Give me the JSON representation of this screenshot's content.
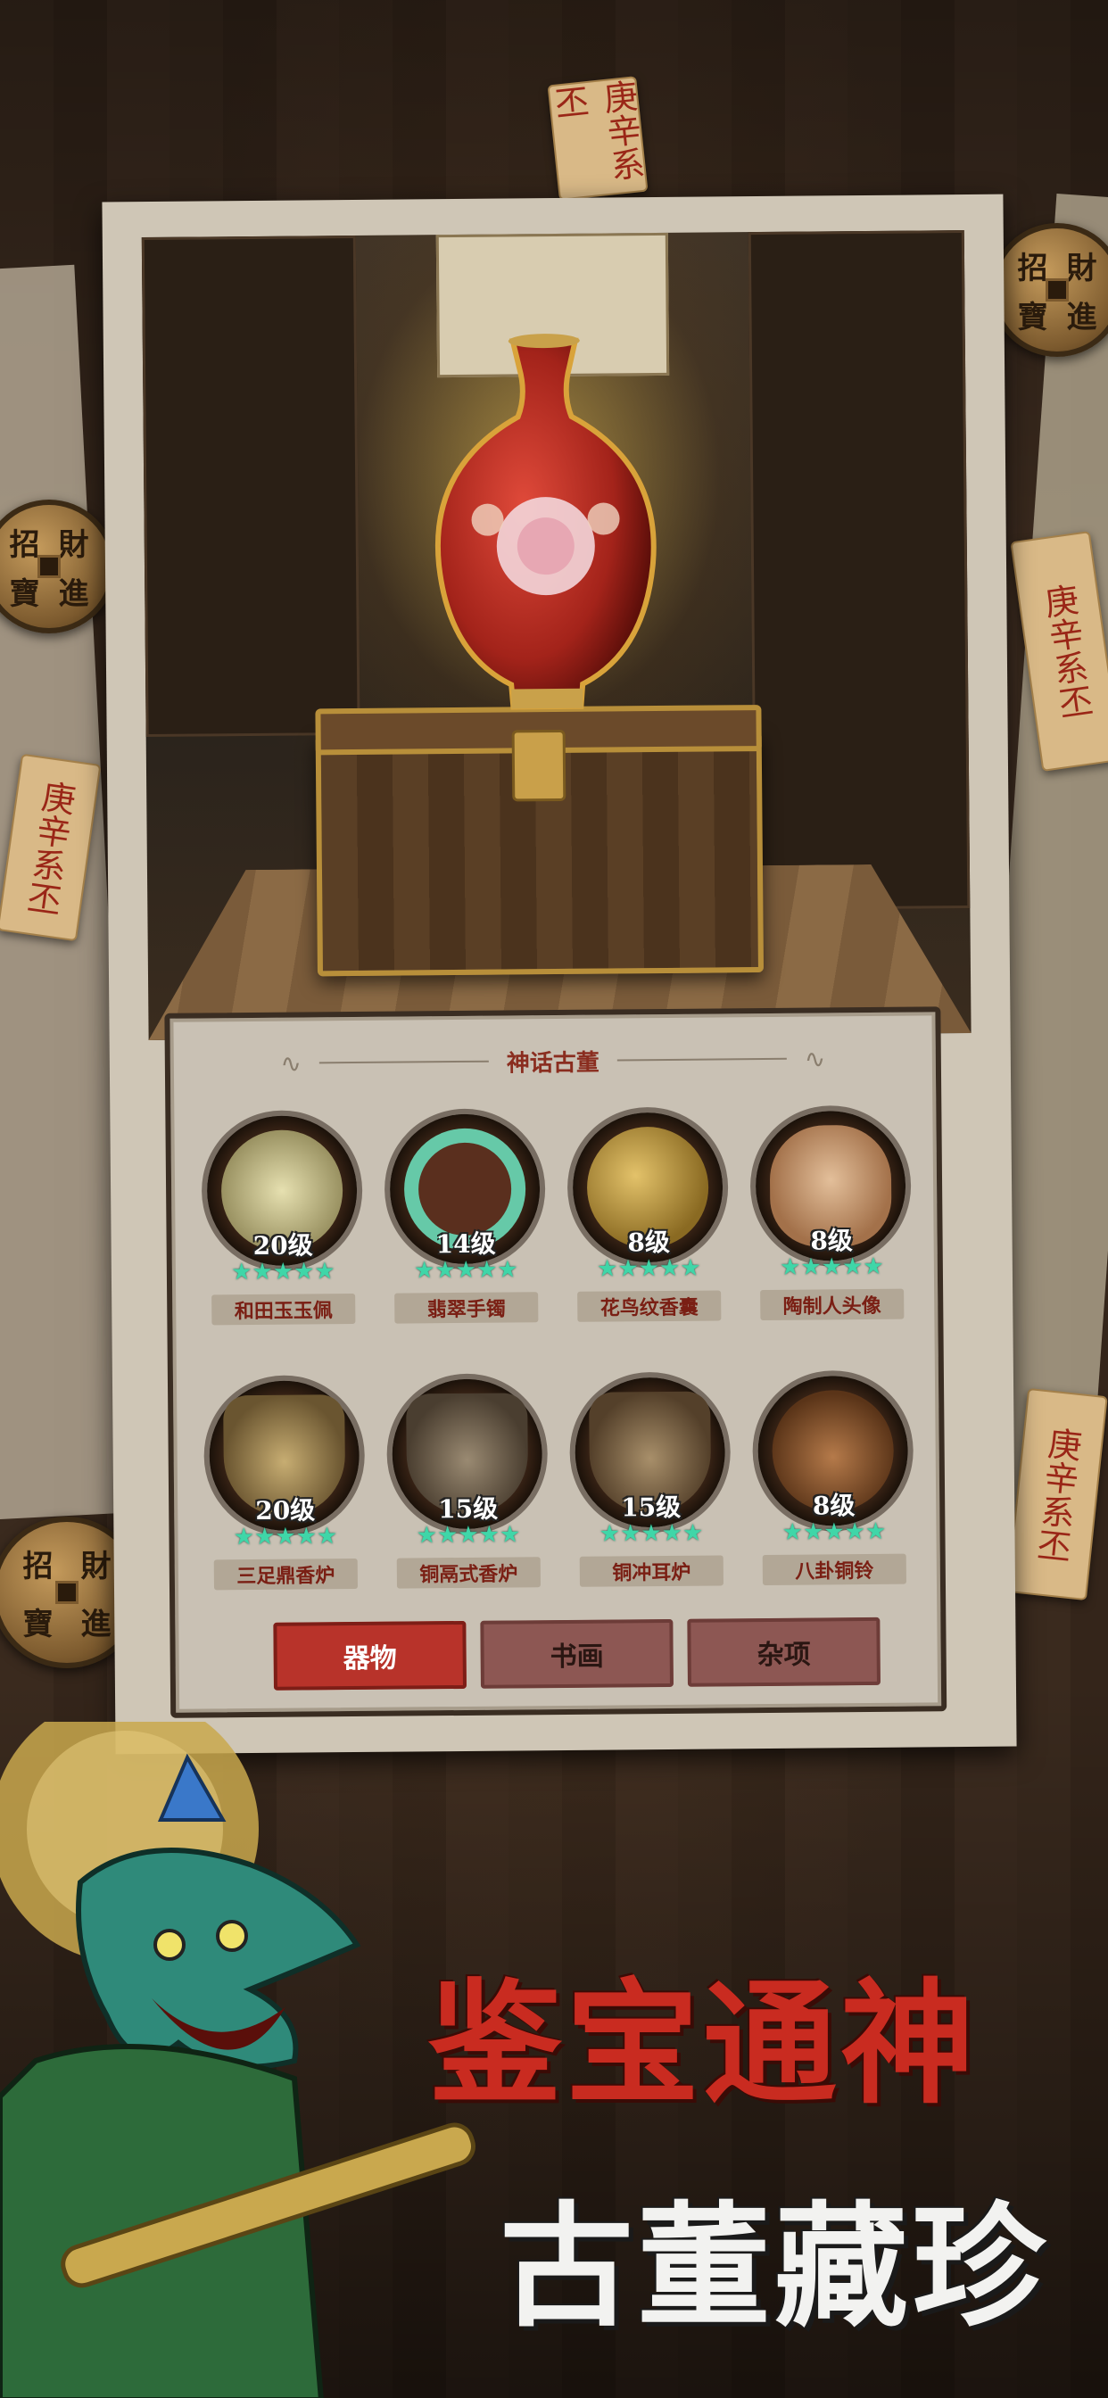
{
  "colors": {
    "accent_red": "#b8332a",
    "tab_idle": "#8d5753",
    "star_green": "#3fd6a8",
    "panel_bg": "#c9c1b4",
    "name_red": "#7a1f14"
  },
  "decor": {
    "coin_chars": [
      "招",
      "財",
      "寶",
      "進"
    ],
    "talisman": "庚辛系丕"
  },
  "panel": {
    "title": "神话古董",
    "items": [
      {
        "name": "和田玉玉佩",
        "level": "20级",
        "icon": "jade-pendant-icon",
        "stars": "★★★★★"
      },
      {
        "name": "翡翠手镯",
        "level": "14级",
        "icon": "jade-bracelet-icon",
        "stars": "★★★★★"
      },
      {
        "name": "花鸟纹香囊",
        "level": "8级",
        "icon": "incense-sachet-icon",
        "stars": "★★★★★"
      },
      {
        "name": "陶制人头像",
        "level": "8级",
        "icon": "ceramic-head-icon",
        "stars": "★★★★★"
      },
      {
        "name": "三足鼎香炉",
        "level": "20级",
        "icon": "tripod-censer-icon",
        "stars": "★★★★★"
      },
      {
        "name": "铜鬲式香炉",
        "level": "15级",
        "icon": "bronze-li-censer-icon",
        "stars": "★★★★★"
      },
      {
        "name": "铜冲耳炉",
        "level": "15级",
        "icon": "bronze-ear-censer-icon",
        "stars": "★★★★★"
      },
      {
        "name": "八卦铜铃",
        "level": "8级",
        "icon": "bagua-bell-icon",
        "stars": "★★★★★"
      }
    ],
    "tabs": [
      {
        "label": "器物",
        "active": true
      },
      {
        "label": "书画",
        "active": false
      },
      {
        "label": "杂项",
        "active": false
      }
    ]
  },
  "slogan": {
    "line1": "鉴宝通神",
    "line2": "古董藏珍"
  }
}
